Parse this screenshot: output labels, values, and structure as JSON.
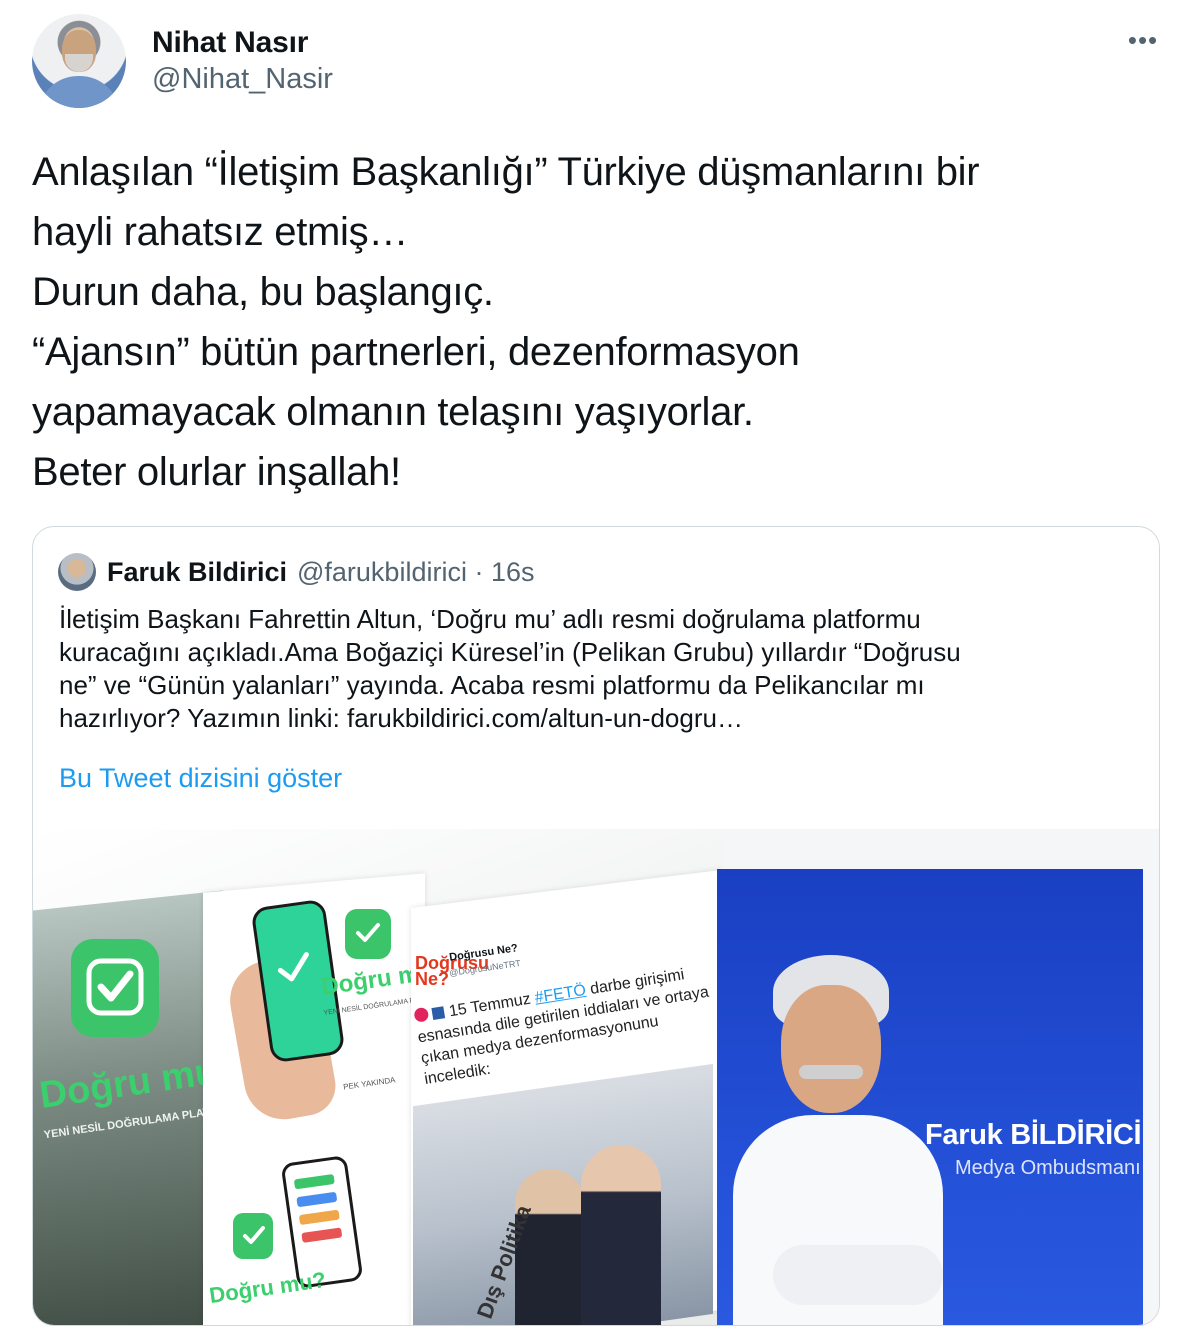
{
  "author": {
    "name": "Nihat Nasır",
    "handle": "@Nihat_Nasir"
  },
  "more_menu_label": "•••",
  "tweet_lines": [
    "Anlaşılan “İletişim Başkanlığı” Türkiye düşmanlarını bir",
    "hayli rahatsız etmiş…",
    "Durun daha, bu başlangıç.",
    "“Ajansın” bütün partnerleri, dezenformasyon",
    "yapamayacak olmanın telaşını yaşıyorlar.",
    "Beter olurlar inşallah!"
  ],
  "quoted": {
    "name": "Faruk Bildirici",
    "handle_time": "@farukbildirici · 16s",
    "text_lines": [
      "İletişim Başkanı Fahrettin Altun, ‘Doğru mu’ adlı resmi doğrulama platformu",
      "kuracağını açıkladı.Ama Boğaziçi Küresel’in (Pelikan Grubu) yıllardır “Doğrusu",
      "ne” ve “Günün yalanları” yayında. Acaba resmi platformu da Pelikancılar mı",
      "hazırlıyor? Yazımın linki: farukbildirici.com/altun-un-dogru…"
    ],
    "show_thread": "Bu Tweet dizisini göster"
  },
  "media": {
    "app_title": "Doğru mu?",
    "app_subtitle": "YENİ NESİL DOĞRULAMA PLATFORMU",
    "app_small": "PEK YAKINDA",
    "embedded_logo": "Doğrusu Ne?",
    "embedded_account": "Doğrusu Ne?",
    "embedded_handle": "@DogrusuNeTRT",
    "embedded_text_prefix": "15 Temmuz",
    "embedded_hashtag": "#FETÖ",
    "embedded_text_rest": "darbe girişimi esnasında dile getirilen iddiaları ve ortaya çıkan medya dezenformasyonunu inceledik:",
    "embedded_label": "Dış Politika",
    "card_name": "Faruk BİLDİRİCİ",
    "card_title": "Medya Ombudsmanı"
  },
  "colors": {
    "link": "#1d9bf0",
    "secondary_text": "#536471",
    "border": "#cfd9de",
    "app_green": "#3cc46a",
    "card_blue": "#2350d6"
  },
  "icons": {
    "more": "more-horizontal-icon",
    "check": "check-icon"
  }
}
